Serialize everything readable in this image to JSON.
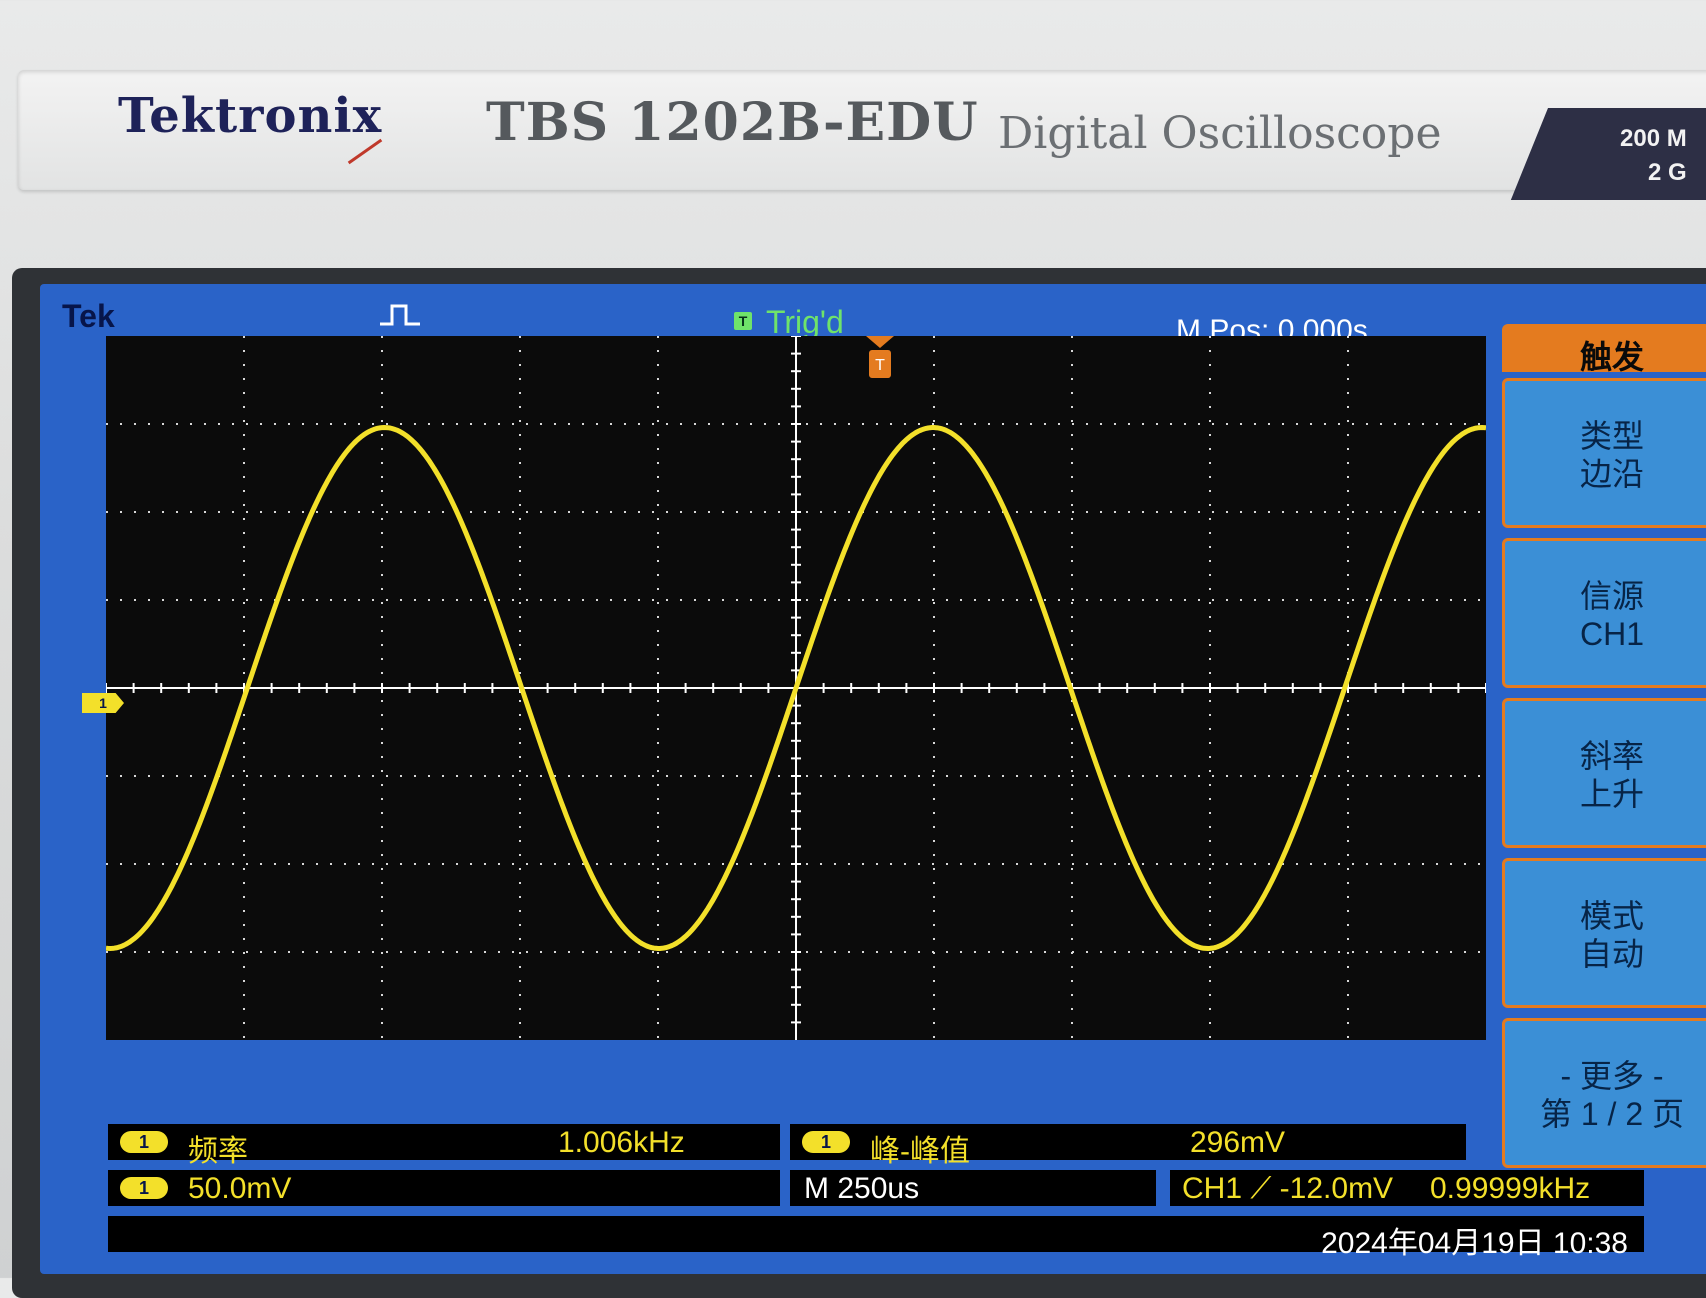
{
  "device": {
    "brand": "Tektronix",
    "model": "TBS 1202B-EDU",
    "product_type": "Digital Oscilloscope",
    "spec_line1": "200 M",
    "spec_line2": "2 G"
  },
  "screen": {
    "tek_label": "Tek",
    "trigger_status": "Trig'd",
    "trigger_status_marker": "T",
    "horizontal_position": "M Pos: 0.000s",
    "channel_marker": "1",
    "trigger_marker": "T"
  },
  "side_menu": {
    "title": "触发",
    "buttons": [
      {
        "line1": "类型",
        "line2": "边沿"
      },
      {
        "line1": "信源",
        "line2": "CH1"
      },
      {
        "line1": "斜率",
        "line2": "上升"
      },
      {
        "line1": "模式",
        "line2": "自动"
      },
      {
        "line1": "- 更多 -",
        "line2": "第 1 / 2 页"
      }
    ]
  },
  "measurements": [
    {
      "channel": "1",
      "label": "频率",
      "value": "1.006kHz"
    },
    {
      "channel": "1",
      "label": "峰-峰值",
      "value": "296mV"
    }
  ],
  "status_bar": {
    "ch1_scale": "50.0mV",
    "ch1_scale_channel": "1",
    "timebase": "M 250us",
    "trigger_info": "CH1 ⟋ -12.0mV",
    "trigger_frequency": "0.99999kHz",
    "datetime": "2024年04月19日 10:38"
  },
  "colors": {
    "screen_frame": "#2a63c8",
    "trace": "#f3e02a",
    "menu_accent": "#e47b1f",
    "menu_button": "#3b8fd6"
  },
  "waveform": {
    "type": "sine",
    "frequency_khz": 1.006,
    "peak_to_peak_mv": 296,
    "volts_per_div_mv": 50,
    "time_per_div_us": 250
  }
}
